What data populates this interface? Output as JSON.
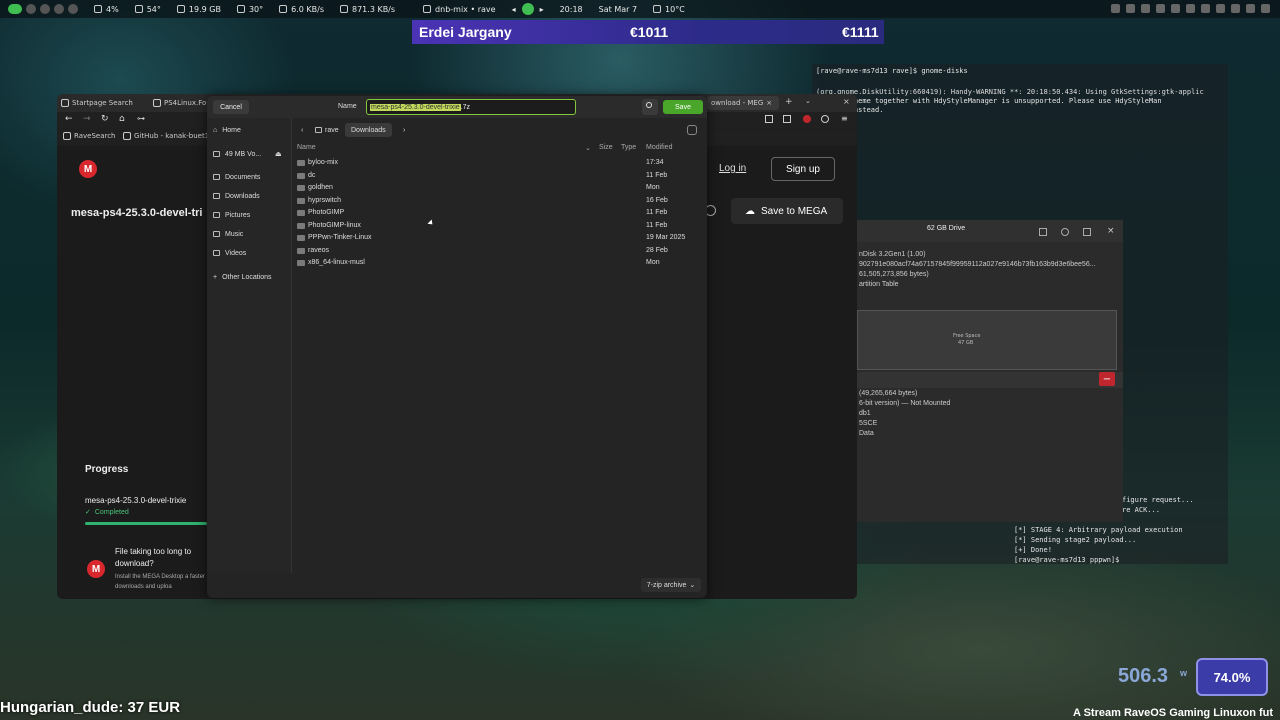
{
  "topbar": {
    "cpu": "4%",
    "cpu_temp": "54°",
    "mem": "19.9 GB",
    "gpu_temp": "30°",
    "net_up": "6.0 KB/s",
    "net_down": "871.3 KB/s",
    "media_title": "dnb-mix • rave",
    "clock": "20:18",
    "date": "Sat Mar 7",
    "weather": "10°C"
  },
  "banner": {
    "name": "Erdei Jargany",
    "amount1": "€1011",
    "amount2": "€1111"
  },
  "browser": {
    "tabs": [
      "Startpage Search",
      "PS4Linux.Fo",
      "ownload - MEG"
    ],
    "bookmarks": [
      "RaveSearch",
      "GitHub - kanak-buet1..."
    ],
    "login": "Log in",
    "signup": "Sign up",
    "file_title": "mesa-ps4-25.3.0-devel-tri",
    "save_to_mega": "Save to MEGA",
    "progress_title": "Progress",
    "progress_file": "mesa-ps4-25.3.0-devel-trixie",
    "progress_status": "Completed",
    "promo_title": "File taking too long to download?",
    "promo_body": "Install the MEGA Desktop a faster downloads and uploa",
    "mega_logo": "M"
  },
  "dialog": {
    "cancel": "Cancel",
    "name_label": "Name",
    "name_selected": "mesa-ps4-25.3.0-devel-trixie",
    "name_ext": ".7z",
    "save": "Save",
    "sidebar": [
      {
        "label": "Home",
        "icon": "home-icon"
      },
      {
        "label": "49 MB Vo...",
        "icon": "drive-icon"
      },
      {
        "label": "Documents",
        "icon": "folder-icon"
      },
      {
        "label": "Downloads",
        "icon": "folder-icon"
      },
      {
        "label": "Pictures",
        "icon": "folder-icon"
      },
      {
        "label": "Music",
        "icon": "folder-icon"
      },
      {
        "label": "Videos",
        "icon": "folder-icon"
      },
      {
        "label": "Other Locations",
        "icon": "plus-icon"
      }
    ],
    "path": [
      "rave",
      "Downloads"
    ],
    "columns": {
      "name": "Name",
      "size": "Size",
      "type": "Type",
      "modified": "Modified"
    },
    "files": [
      {
        "name": "byloo-mix",
        "modified": "17:34"
      },
      {
        "name": "dc",
        "modified": "11 Feb"
      },
      {
        "name": "goldhen",
        "modified": "Mon"
      },
      {
        "name": "hyprswitch",
        "modified": "16 Feb"
      },
      {
        "name": "PhotoGIMP",
        "modified": "11 Feb"
      },
      {
        "name": "PhotoGIMP-linux",
        "modified": "11 Feb"
      },
      {
        "name": "PPPwn-Tinker-Linux",
        "modified": "19 Mar 2025"
      },
      {
        "name": "raveos",
        "modified": "28 Feb"
      },
      {
        "name": "x86_64-linux-musl",
        "modified": "Mon"
      }
    ],
    "filter": "7-zip archive"
  },
  "disks": {
    "title": "62 GB Drive",
    "lines": [
      "nDisk 3.2Gen1 (1.00)",
      "902791e080acf74a67157845f99959112a027e9146b73fb163b9d3e6bee56...",
      "61,505,273,856 bytes)",
      "artition Table",
      "(49,265,664 bytes)",
      "6-bit version) — Not Mounted",
      "db1",
      "5SCE",
      "Data"
    ],
    "free_space": "Free Space",
    "free_size": "47 GB"
  },
  "terminal": {
    "lines_top": [
      "[rave@rave-ms7d13 rave]$ gnome-disks",
      "",
      "(org.gnome.DiskUtility:660419): Handy-WARNING **: 20:18:50.434: Using GtkSettings:gtk-applic",
      "er-dark-theme together with HdyStyleManager is unsupported. Please use HdyStyleMan",
      "-scheme instead."
    ],
    "lines_mid": [
      "figure request...",
      "re ACK..."
    ],
    "lines_bottom": [
      "[*] STAGE 4: Arbitrary payload execution",
      "[*] Sending stage2 payload...",
      "[+] Done!",
      "[rave@rave-ms7d13 pppwn]$ "
    ]
  },
  "overlay": {
    "donation": "Hungarian_dude: 37 EUR",
    "watts": "506.3",
    "watts_unit": "w",
    "percent": "74.0%",
    "ticker": "A Stream RaveOS Gaming Linuxon fut"
  }
}
